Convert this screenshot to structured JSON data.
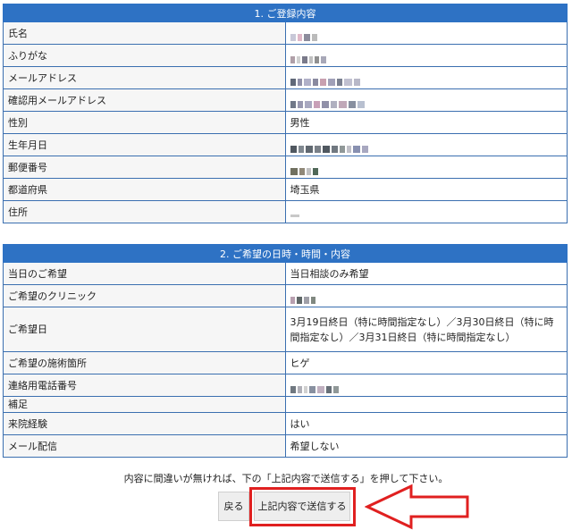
{
  "section1": {
    "title": "1. ご登録内容",
    "rows": [
      {
        "label": "氏名",
        "value": ""
      },
      {
        "label": "ふりがな",
        "value": ""
      },
      {
        "label": "メールアドレス",
        "value": ""
      },
      {
        "label": "確認用メールアドレス",
        "value": ""
      },
      {
        "label": "性別",
        "value": "男性"
      },
      {
        "label": "生年月日",
        "value": ""
      },
      {
        "label": "郵便番号",
        "value": ""
      },
      {
        "label": "都道府県",
        "value": "埼玉県"
      },
      {
        "label": "住所",
        "value": ""
      }
    ]
  },
  "section2": {
    "title": "2. ご希望の日時・時間・内容",
    "rows": [
      {
        "label": "当日のご希望",
        "value": "当日相談のみ希望"
      },
      {
        "label": "ご希望のクリニック",
        "value": ""
      },
      {
        "label": "ご希望日",
        "value": "3月19日終日（特に時間指定なし）／3月30日終日（特に時間指定なし）／3月31日終日（特に時間指定なし）"
      },
      {
        "label": "ご希望の施術箇所",
        "value": "ヒゲ"
      },
      {
        "label": "連絡用電話番号",
        "value": ""
      },
      {
        "label": "補足",
        "value": ""
      },
      {
        "label": "来院経験",
        "value": "はい"
      },
      {
        "label": "メール配信",
        "value": "希望しない"
      }
    ]
  },
  "confirm_note": "内容に間違いが無ければ、下の「上記内容で送信する」を押して下さい。",
  "buttons": {
    "back": "戻る",
    "submit": "上記内容で送信する"
  },
  "colors": {
    "header_bg": "#2e72c4",
    "border": "#3b6fb0",
    "highlight": "#e02020"
  }
}
